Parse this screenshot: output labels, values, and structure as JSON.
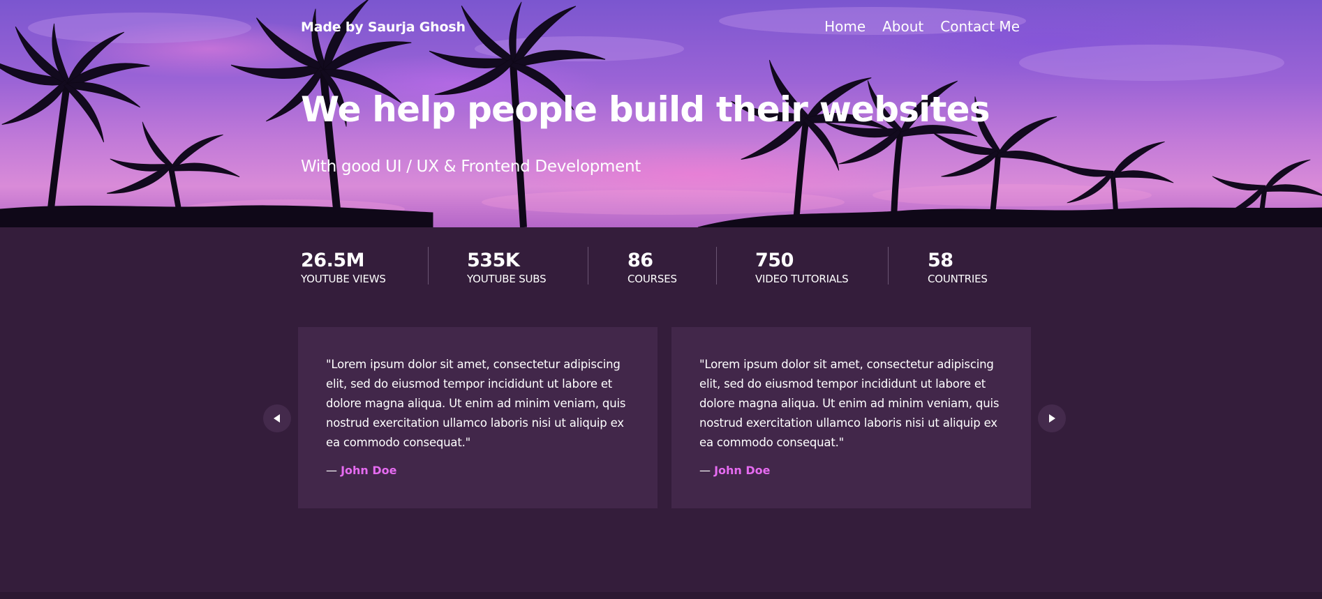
{
  "header": {
    "brand": "Made by Saurja Ghosh",
    "nav": [
      {
        "label": "Home"
      },
      {
        "label": "About"
      },
      {
        "label": "Contact Me"
      }
    ]
  },
  "hero": {
    "title": "We help people build their websites",
    "subtitle": "With good UI / UX & Frontend Development",
    "background_icon": "palm-trees-sunset-image"
  },
  "stats": [
    {
      "value": "26.5M",
      "label": "YOUTUBE VIEWS"
    },
    {
      "value": "535K",
      "label": "YOUTUBE SUBS"
    },
    {
      "value": "86",
      "label": "COURSES"
    },
    {
      "value": "750",
      "label": "VIDEO TUTORIALS"
    },
    {
      "value": "58",
      "label": "COUNTRIES"
    }
  ],
  "testimonials": [
    {
      "quote": "\"Lorem ipsum dolor sit amet, consectetur adipiscing elit, sed do eiusmod tempor incididunt ut labore et dolore magna aliqua. Ut enim ad minim veniam, quis nostrud exercitation ullamco laboris nisi ut aliquip ex ea commodo consequat.\"",
      "dash": "—",
      "author": "John Doe"
    },
    {
      "quote": "\"Lorem ipsum dolor sit amet, consectetur adipiscing elit, sed do eiusmod tempor incididunt ut labore et dolore magna aliqua. Ut enim ad minim veniam, quis nostrud exercitation ullamco laboris nisi ut aliquip ex ea commodo consequat.\"",
      "dash": "—",
      "author": "John Doe"
    }
  ],
  "carousel": {
    "prev_icon": "triangle-left-icon",
    "next_icon": "triangle-right-icon"
  },
  "colors": {
    "page_background": "#341d3b",
    "card_background": "#42274a",
    "author_accent": "#e56bf0",
    "hero_sky": "#9a63d6"
  }
}
